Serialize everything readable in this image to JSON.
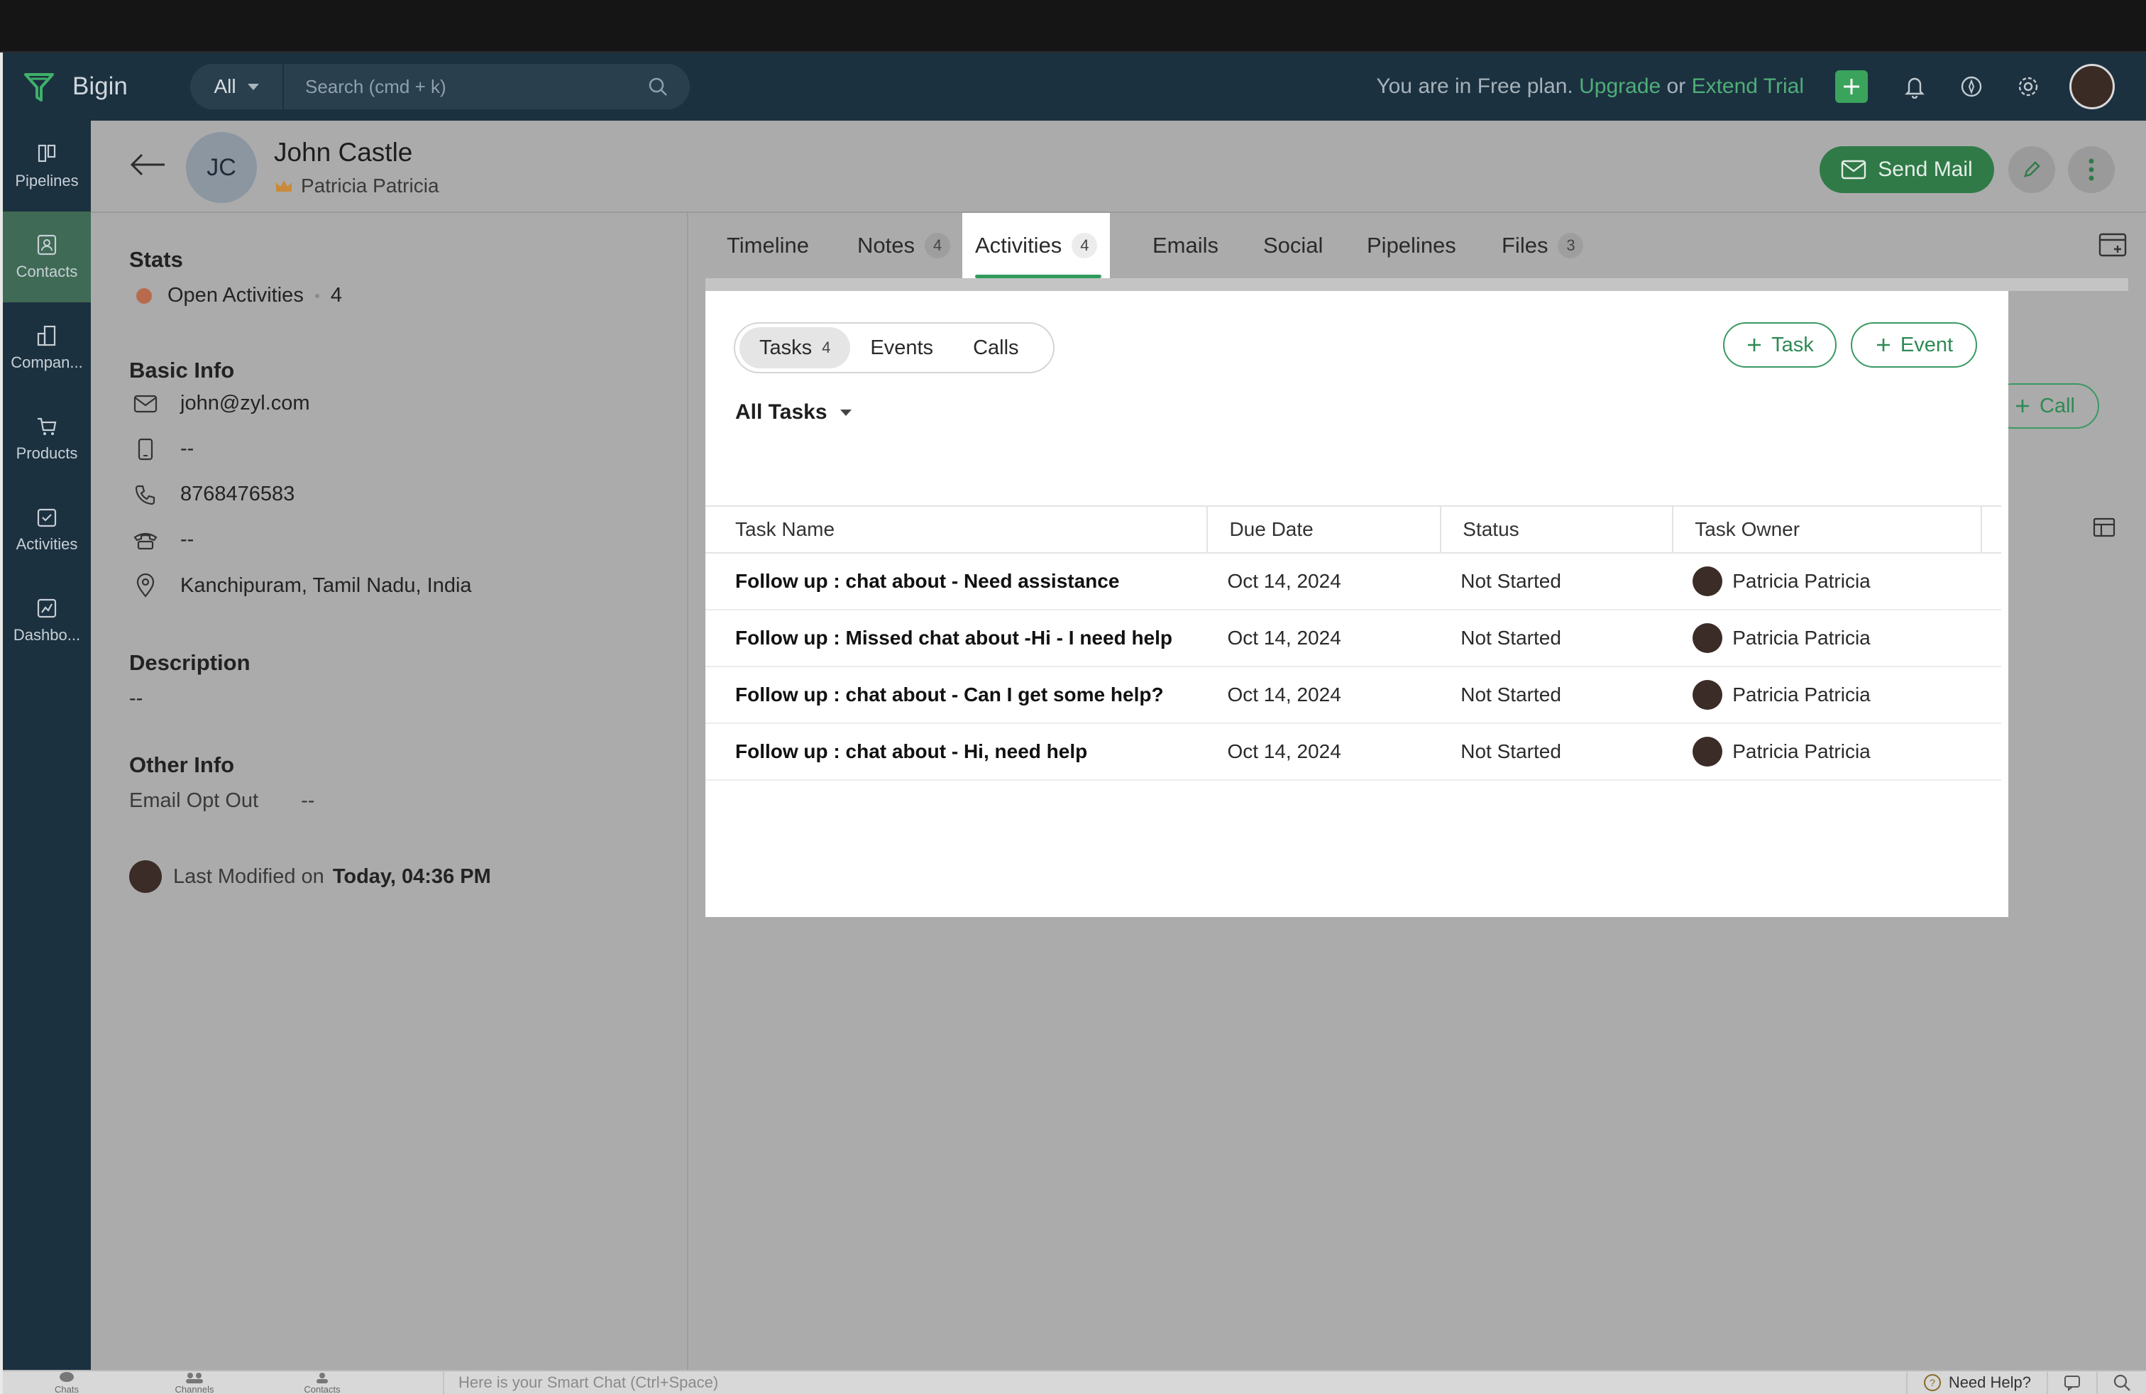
{
  "app": {
    "name": "Bigin"
  },
  "search": {
    "scope": "All",
    "placeholder": "Search (cmd + k)"
  },
  "plan": {
    "text": "You are in Free plan.",
    "upgrade": "Upgrade",
    "or": "or",
    "extend": "Extend Trial"
  },
  "nav": [
    {
      "label": "Pipelines",
      "icon": "pipelines-icon"
    },
    {
      "label": "Contacts",
      "icon": "contacts-icon",
      "active": true
    },
    {
      "label": "Compan...",
      "icon": "companies-icon"
    },
    {
      "label": "Products",
      "icon": "products-icon"
    },
    {
      "label": "Activities",
      "icon": "activities-icon"
    },
    {
      "label": "Dashbo...",
      "icon": "dashboards-icon"
    }
  ],
  "contact": {
    "initials": "JC",
    "name": "John Castle",
    "owner": "Patricia Patricia",
    "send_mail": "Send Mail"
  },
  "details": {
    "stats_title": "Stats",
    "open_activities_label": "Open Activities",
    "open_activities_count": "4",
    "basic_info_title": "Basic Info",
    "email": "john@zyl.com",
    "mobile": "--",
    "phone": "8768476583",
    "other_phone": "--",
    "address": "Kanchipuram, Tamil Nadu, India",
    "description_title": "Description",
    "description": "--",
    "other_info_title": "Other Info",
    "email_opt_out_label": "Email Opt Out",
    "email_opt_out_value": "--",
    "last_modified_label": "Last Modified on",
    "last_modified_value": "Today, 04:36 PM"
  },
  "tabs": [
    {
      "label": "Timeline",
      "count": ""
    },
    {
      "label": "Notes",
      "count": "4"
    },
    {
      "label": "Activities",
      "count": "4",
      "active": true
    },
    {
      "label": "Emails",
      "count": ""
    },
    {
      "label": "Social",
      "count": ""
    },
    {
      "label": "Pipelines",
      "count": ""
    },
    {
      "label": "Files",
      "count": "3"
    }
  ],
  "activities": {
    "segments": [
      {
        "label": "Tasks",
        "count": "4",
        "active": true
      },
      {
        "label": "Events",
        "count": ""
      },
      {
        "label": "Calls",
        "count": ""
      }
    ],
    "add_task": "Task",
    "add_event": "Event",
    "add_call": "Call",
    "filter": "All Tasks",
    "columns": [
      "Task Name",
      "Due Date",
      "Status",
      "Task Owner"
    ],
    "rows": [
      {
        "name": "Follow up : chat about - Need assistance",
        "due": "Oct 14, 2024",
        "status": "Not Started",
        "owner": "Patricia Patricia"
      },
      {
        "name": "Follow up : Missed chat about -Hi - I need help",
        "due": "Oct 14, 2024",
        "status": "Not Started",
        "owner": "Patricia Patricia"
      },
      {
        "name": "Follow up : chat about - Can I get some help?",
        "due": "Oct 14, 2024",
        "status": "Not Started",
        "owner": "Patricia Patricia"
      },
      {
        "name": "Follow up : chat about - Hi, need help",
        "due": "Oct 14, 2024",
        "status": "Not Started",
        "owner": "Patricia Patricia"
      }
    ]
  },
  "bottom": {
    "chats": "Chats",
    "channels": "Channels",
    "contacts": "Contacts",
    "smart_chat": "Here is your Smart Chat (Ctrl+Space)",
    "need_help": "Need Help?"
  },
  "colors": {
    "header": "#1c3140",
    "accent_green": "#2f9a5c",
    "active_nav": "#3f6a56"
  }
}
